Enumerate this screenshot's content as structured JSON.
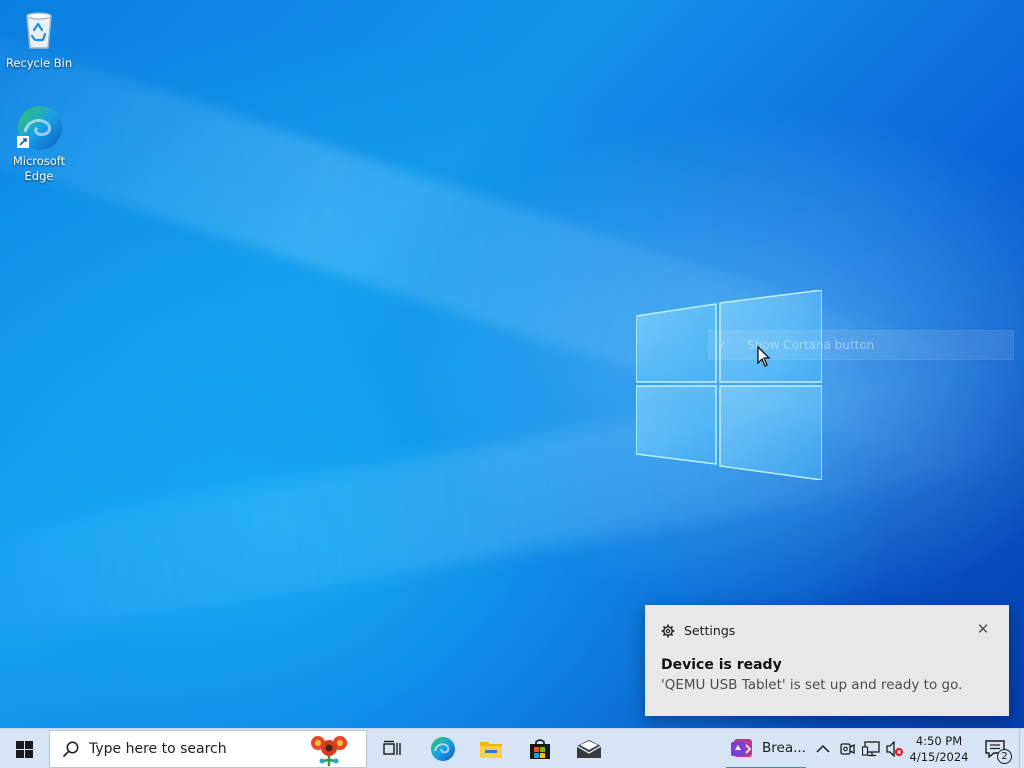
{
  "desktop": {
    "icons": [
      {
        "label": "Recycle Bin",
        "icon": "recycle-bin-icon"
      },
      {
        "label": "Microsoft Edge",
        "icon": "edge-icon"
      }
    ],
    "wallpaper": "windows-10-hero",
    "accent": "#0b63d8"
  },
  "context_menu": {
    "item_label": "Show Cortana button",
    "checked": true
  },
  "notification": {
    "app_name": "Settings",
    "app_icon": "gear-icon",
    "title": "Device is ready",
    "body": "'QEMU USB Tablet' is set up and ready to go.",
    "close_label": "✕"
  },
  "taskbar": {
    "search_placeholder": "Type here to search",
    "pinned": [
      "task-view",
      "microsoft-edge",
      "file-explorer",
      "microsoft-store",
      "mail"
    ],
    "running_app_label": "Brea...",
    "clock_time": "4:50 PM",
    "clock_date": "4/15/2024",
    "notification_count": "2",
    "background": "#d6e4f3"
  }
}
